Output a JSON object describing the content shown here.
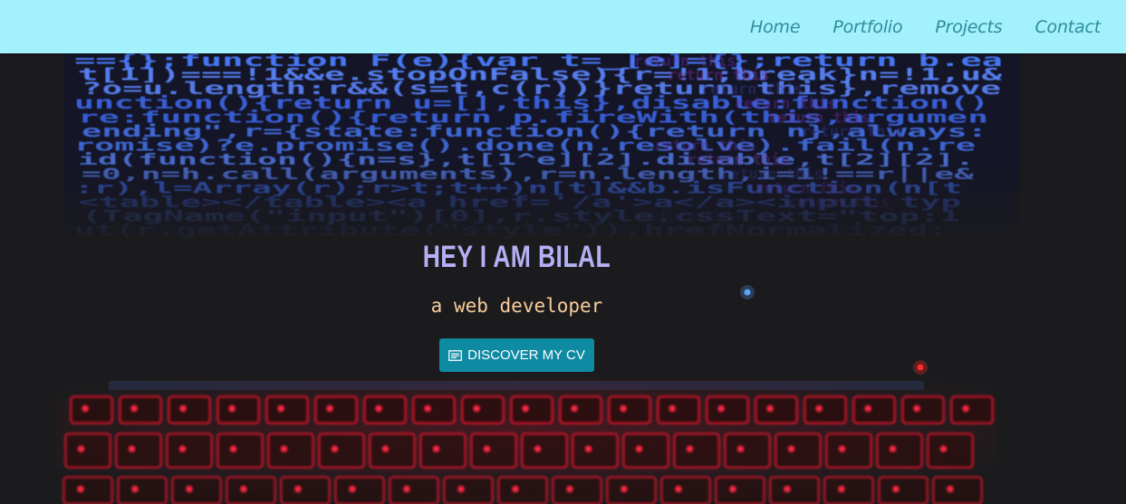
{
  "nav": {
    "links": [
      "Home",
      "Portfolio",
      "Projects",
      "Contact"
    ]
  },
  "hero": {
    "title": "HEY I AM BILAL",
    "subtitle": "a web developer",
    "cta_label": "DISCOVER MY CV",
    "cta_icon": "document-icon"
  },
  "colors": {
    "navbar_bg": "#a3f1fb",
    "nav_link": "#2f8d9b",
    "title": "#b5b0f5",
    "subtitle": "#f9cb9c",
    "button_bg": "#0e8aa3",
    "code_blue": "#3d6bff",
    "keyboard_red": "#ff1a33"
  }
}
